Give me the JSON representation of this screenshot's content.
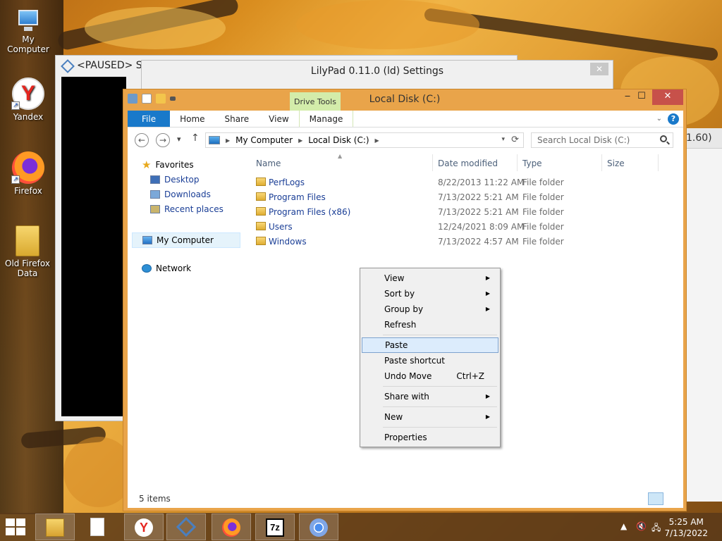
{
  "desktop": {
    "icons": [
      {
        "label": "My Computer"
      },
      {
        "label": "Yandex"
      },
      {
        "label": "Firefox"
      },
      {
        "label": "Old Firefox Data"
      }
    ]
  },
  "pcsx2": {
    "title": "<PAUSED> Sl"
  },
  "lilypad": {
    "title": "LilyPad 0.11.0 (ld) Settings",
    "close": "✕"
  },
  "right_window": {
    "text": "1.60)"
  },
  "explorer": {
    "title": "Local Disk (C:)",
    "context_tab": "Drive Tools",
    "tabs": [
      "File",
      "Home",
      "Share",
      "View",
      "Manage"
    ],
    "breadcrumb": [
      "My Computer",
      "Local Disk (C:)"
    ],
    "search_placeholder": "Search Local Disk (C:)",
    "nav": {
      "favorites": "Favorites",
      "desktop": "Desktop",
      "downloads": "Downloads",
      "recent": "Recent places",
      "computer": "My Computer",
      "network": "Network"
    },
    "columns": [
      "Name",
      "Date modified",
      "Type",
      "Size"
    ],
    "files": [
      {
        "name": "PerfLogs",
        "date": "8/22/2013 11:22 AM",
        "type": "File folder"
      },
      {
        "name": "Program Files",
        "date": "7/13/2022 5:21 AM",
        "type": "File folder"
      },
      {
        "name": "Program Files (x86)",
        "date": "7/13/2022 5:21 AM",
        "type": "File folder"
      },
      {
        "name": "Users",
        "date": "12/24/2021 8:09 AM",
        "type": "File folder"
      },
      {
        "name": "Windows",
        "date": "7/13/2022 4:57 AM",
        "type": "File folder"
      }
    ],
    "status": "5 items"
  },
  "context_menu": {
    "view": "View",
    "sort_by": "Sort by",
    "group_by": "Group by",
    "refresh": "Refresh",
    "paste": "Paste",
    "paste_shortcut": "Paste shortcut",
    "undo_move": "Undo Move",
    "undo_shortcut": "Ctrl+Z",
    "share_with": "Share with",
    "new": "New",
    "properties": "Properties"
  },
  "taskbar": {
    "time": "5:25 AM",
    "date": "7/13/2022",
    "sevenzip": "7z"
  },
  "icons": {
    "start": "windows-logo-icon",
    "explorer": "folder-icon",
    "yandex": "yandex-icon",
    "pcsx2": "pcsx2-icon",
    "firefox": "firefox-icon",
    "chrome": "chrome-icon"
  }
}
